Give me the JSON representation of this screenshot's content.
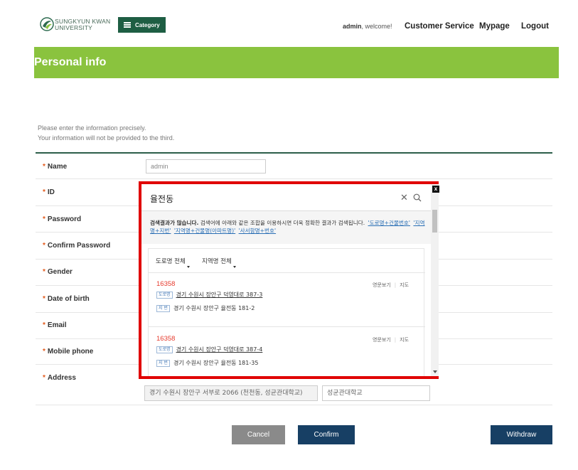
{
  "header": {
    "logo_line1": "SUNGKYUN KWAN",
    "logo_line2": "UNIVERSITY",
    "category_label": "Category",
    "welcome_user": "admin",
    "welcome_suffix": ", welcome!",
    "nav": [
      "Customer Service",
      "Mypage",
      "Logout"
    ]
  },
  "banner": {
    "title": "Personal info"
  },
  "intro": {
    "line1": "Please enter the information precisely.",
    "line2": "Your information will not be provided to the third."
  },
  "form": {
    "labels": [
      "Name",
      "ID",
      "Password",
      "Confirm Password",
      "Gender",
      "Date of birth",
      "Email",
      "Mobile phone",
      "Address"
    ],
    "name_value": "admin",
    "address_line": "경기 수원시 장안구 서부로 2066 (천천동, 성균관대학교)",
    "address_detail": "성균관대학교"
  },
  "buttons": {
    "cancel": "Cancel",
    "confirm": "Confirm",
    "withdraw": "Withdraw"
  },
  "popup": {
    "close_label": "x",
    "search_value": "율전동",
    "tip_bold": "검색결과가 많습니다.",
    "tip_text": " 검색어에 아래와 같은 조합을 이용하시면 더욱 정확한 결과가 검색됩니다.",
    "tip_links": [
      "'도로명+건물번호'",
      "'지역명+지번'",
      "'지역명+건물명(아파트명)'",
      "'사서함명+번호'"
    ],
    "filters": [
      "도로명 전체",
      "지역명 전체"
    ],
    "results": [
      {
        "zip": "16358",
        "road_tag": "도로명",
        "road": "경기 수원시 장안구 덕영대로 387-3",
        "jibun_tag": "지 번",
        "jibun": "경기 수원시 장안구 율전동 181-2",
        "eng": "영문보기",
        "map": "지도"
      },
      {
        "zip": "16358",
        "road_tag": "도로명",
        "road": "경기 수원시 장안구 덕영대로 387-4",
        "jibun_tag": "지 번",
        "jibun": "경기 수원시 장안구 율전동 181-35",
        "eng": "영문보기",
        "map": "지도"
      }
    ]
  },
  "colors": {
    "brand_green": "#1e5e43",
    "banner_green": "#8ac33e",
    "navy": "#173f64",
    "highlight_red": "#e00000",
    "zip_red": "#e63b2e"
  }
}
